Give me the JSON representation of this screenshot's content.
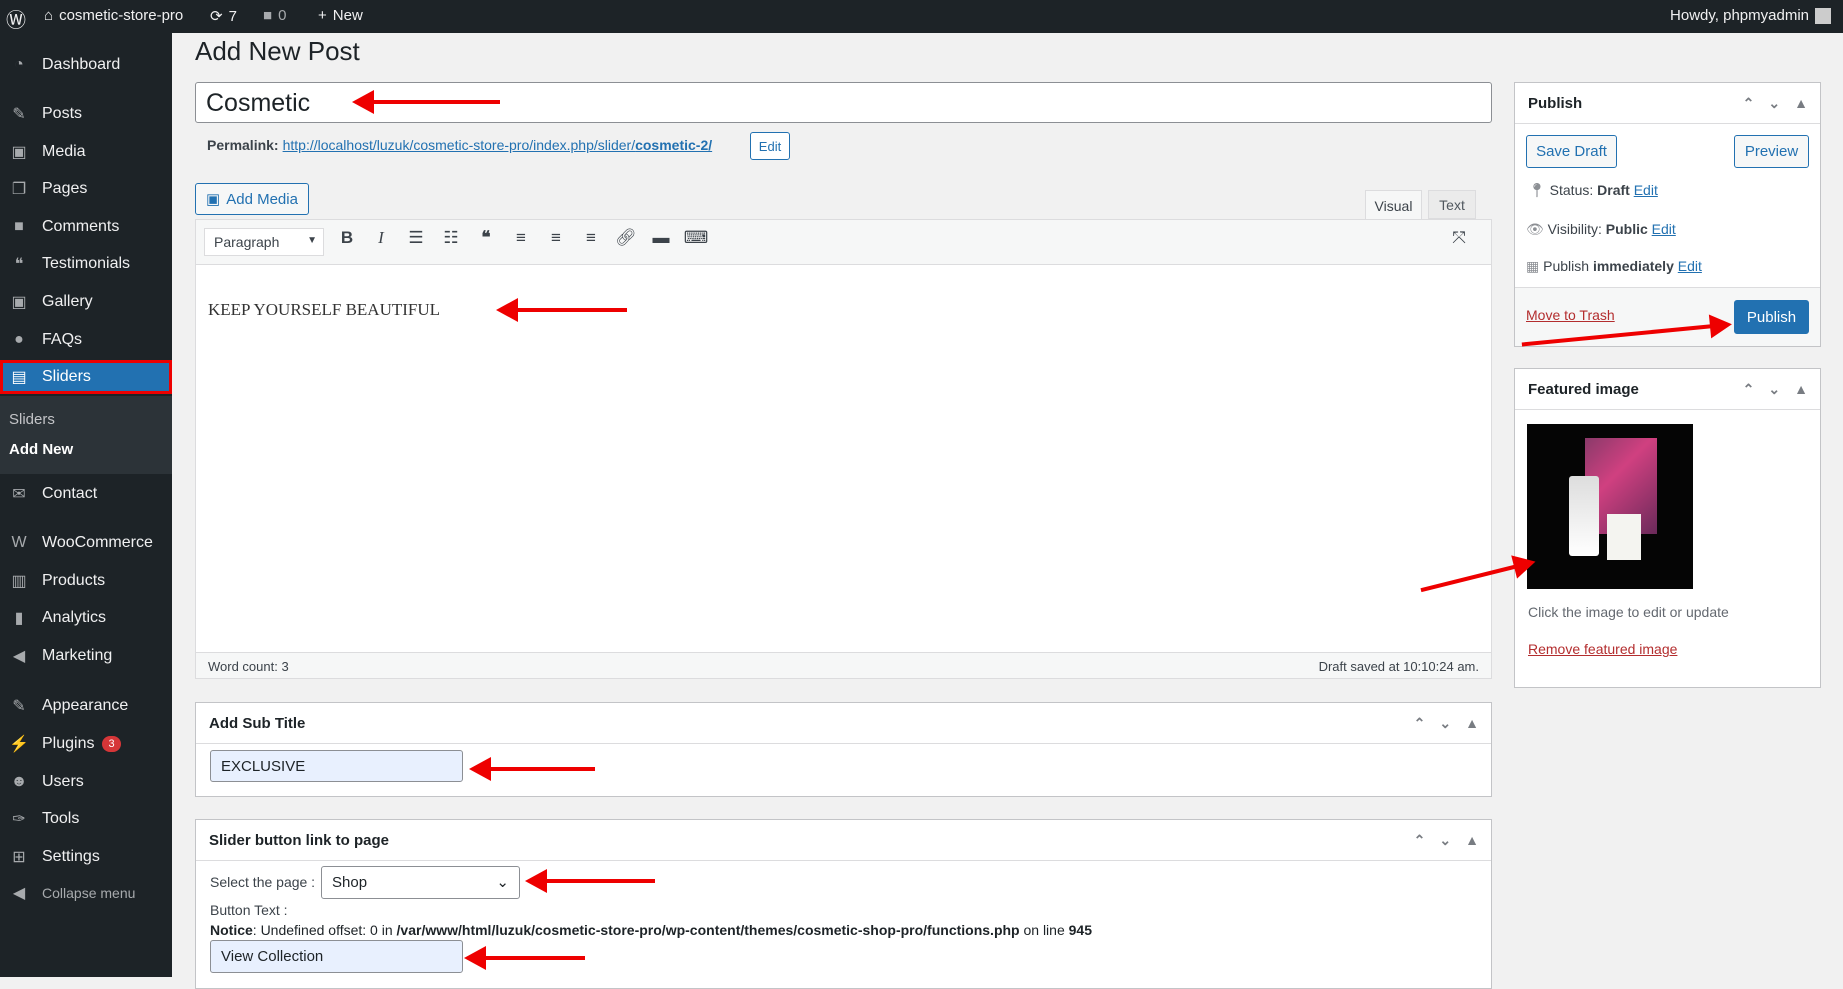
{
  "adminbar": {
    "site": "cosmetic-store-pro",
    "updates": "7",
    "comments": "0",
    "new": "New",
    "howdy": "Howdy, phpmyadmin"
  },
  "sidebar": {
    "items": [
      {
        "label": "Dashboard",
        "icon": "◔"
      },
      {
        "label": "Posts",
        "icon": "✎"
      },
      {
        "label": "Media",
        "icon": "▣"
      },
      {
        "label": "Pages",
        "icon": "❐"
      },
      {
        "label": "Comments",
        "icon": "■"
      },
      {
        "label": "Testimonials",
        "icon": "❝"
      },
      {
        "label": "Gallery",
        "icon": "▣"
      },
      {
        "label": "FAQs",
        "icon": "●"
      },
      {
        "label": "Sliders",
        "icon": "▤"
      },
      {
        "label": "Contact",
        "icon": "✉"
      },
      {
        "label": "WooCommerce",
        "icon": "W"
      },
      {
        "label": "Products",
        "icon": "▥"
      },
      {
        "label": "Analytics",
        "icon": "▮"
      },
      {
        "label": "Marketing",
        "icon": "◀"
      },
      {
        "label": "Appearance",
        "icon": "✎"
      },
      {
        "label": "Plugins",
        "icon": "⚡"
      },
      {
        "label": "Users",
        "icon": "☻"
      },
      {
        "label": "Tools",
        "icon": "✑"
      },
      {
        "label": "Settings",
        "icon": "⊞"
      },
      {
        "label": "Collapse menu",
        "icon": "◀"
      }
    ],
    "submenu": [
      "Sliders",
      "Add New"
    ],
    "plugins_badge": "3"
  },
  "page": {
    "title": "Add New Post",
    "post_title": "Cosmetic",
    "permalink_label": "Permalink:",
    "permalink_url": "http://localhost/luzuk/cosmetic-store-pro/index.php/slider/",
    "permalink_slug": "cosmetic-2/",
    "edit": "Edit"
  },
  "editor": {
    "add_media": "Add Media",
    "tab_visual": "Visual",
    "tab_text": "Text",
    "format": "Paragraph",
    "content": "KEEP YOURSELF BEAUTIFUL",
    "word_count": "Word count: 3",
    "draft_saved": "Draft saved at 10:10:24 am."
  },
  "subtitle": {
    "title": "Add Sub Title",
    "value": "EXCLUSIVE"
  },
  "slider_link": {
    "title": "Slider button link to page",
    "select_label": "Select the page :",
    "selected": "Shop",
    "button_text_label": "Button Text :",
    "notice_label": "Notice",
    "notice_text": ": Undefined offset: 0 in ",
    "notice_path": "/var/www/html/luzuk/cosmetic-store-pro/wp-content/themes/cosmetic-shop-pro/functions.php",
    "notice_line_text": " on line ",
    "notice_line": "945",
    "button_value": "View Collection"
  },
  "publish": {
    "title": "Publish",
    "save_draft": "Save Draft",
    "preview": "Preview",
    "status_label": "Status: ",
    "status": "Draft",
    "visibility_label": "Visibility: ",
    "visibility": "Public",
    "publish_label": "Publish ",
    "publish_when": "immediately",
    "edit": "Edit",
    "trash": "Move to Trash",
    "publish_btn": "Publish"
  },
  "featured": {
    "title": "Featured image",
    "hint": "Click the image to edit or update",
    "remove": "Remove featured image"
  },
  "colors": {
    "accent": "#2271b1",
    "annotation_arrow": "#ee0000",
    "sidebar": "#1d2327"
  }
}
